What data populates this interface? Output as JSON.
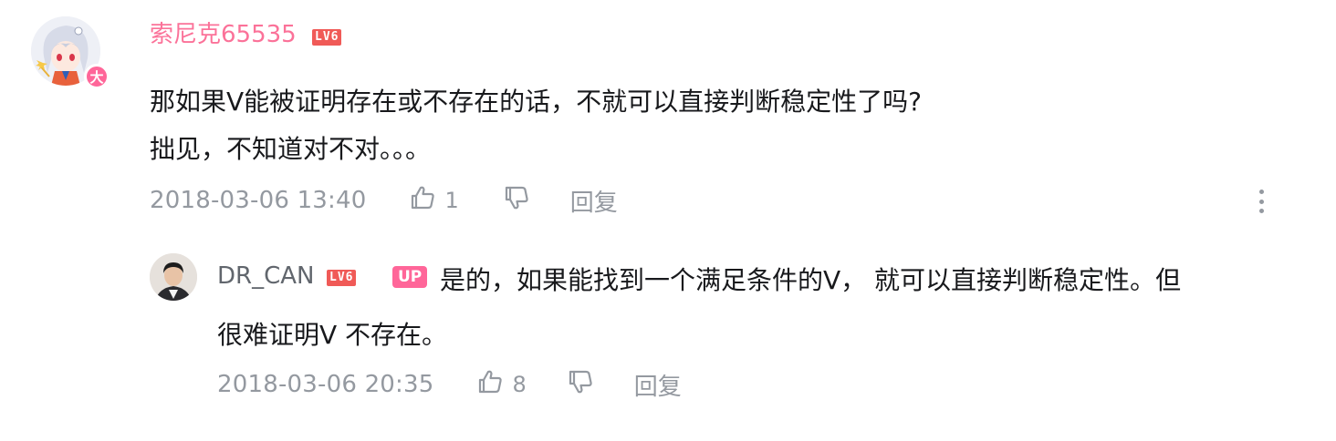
{
  "root_comment": {
    "username": "索尼克65535",
    "level": "LV6",
    "vip_badge": "大",
    "lines": [
      "那如果V能被证明存在或不存在的话，不就可以直接判断稳定性了吗?",
      "拙见，不知道对不对。。。"
    ],
    "time": "2018-03-06 13:40",
    "likes": "1",
    "reply_label": "回复"
  },
  "sub_reply": {
    "username": "DR_CAN",
    "level": "LV6",
    "up_badge": "UP",
    "line1": "是的，如果能找到一个满足条件的V， 就可以直接判断稳定性。但",
    "line2": "很难证明V 不存在。",
    "time": "2018-03-06 20:35",
    "likes": "8",
    "reply_label": "回复"
  },
  "colors": {
    "username_vip": "#fb7299",
    "username_normal": "#61666d",
    "meta_gray": "#9499a0",
    "level_red": "#f05a57",
    "up_pink": "#ff6699"
  },
  "icons": {
    "like": "thumbs-up-icon",
    "dislike": "thumbs-down-icon",
    "more": "more-vertical-icon"
  }
}
